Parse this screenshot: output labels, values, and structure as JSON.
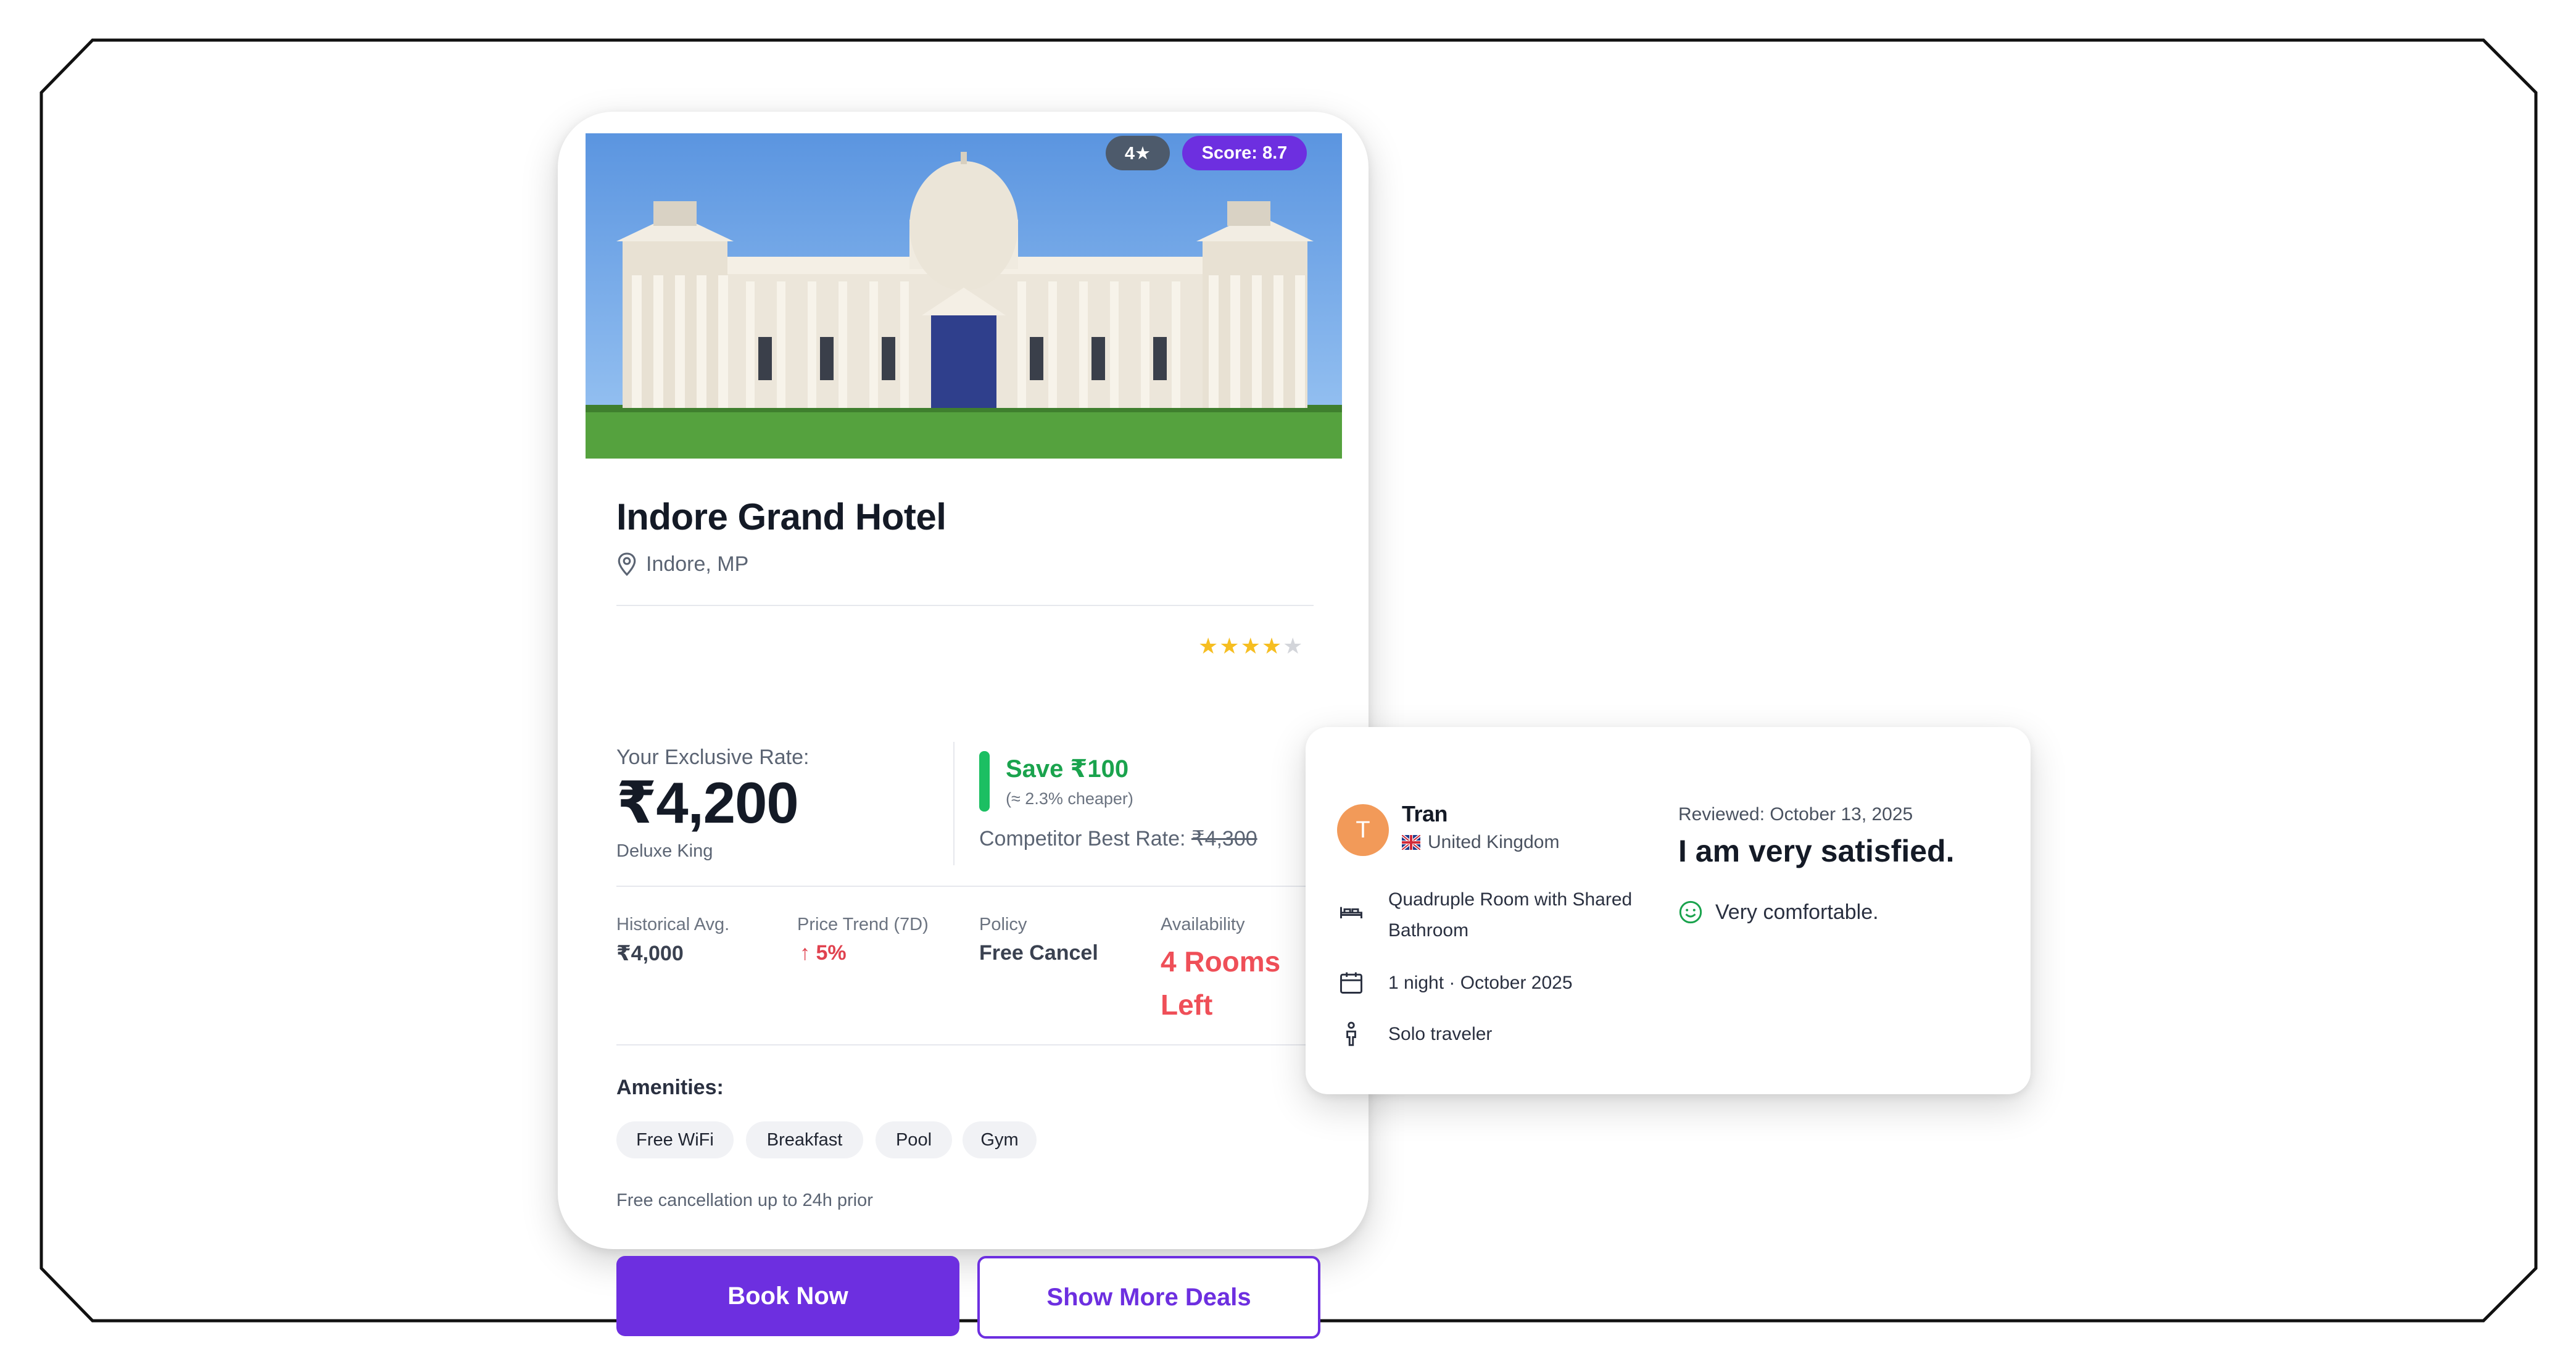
{
  "hotel": {
    "star_badge": "4★",
    "score_badge": "Score: 8.7",
    "name": "Indore Grand Hotel",
    "location": "Indore, MP",
    "star_rating": 4,
    "rate_label": "Your Exclusive Rate:",
    "price": "₹4,200",
    "room_type": "Deluxe King",
    "save_title": "Save ₹100",
    "save_sub": "(≈ 2.3% cheaper)",
    "competitor_label": "Competitor Best Rate:",
    "competitor_price": "₹4,300",
    "stats": {
      "historical_label": "Historical Avg.",
      "historical_value": "₹4,000",
      "trend_label": "Price Trend (7D)",
      "trend_value": "↑ 5%",
      "policy_label": "Policy",
      "policy_value": "Free Cancel",
      "availability_label": "Availability",
      "availability_value": "4 Rooms Left"
    },
    "amenities_title": "Amenities:",
    "amenities": [
      "Free WiFi",
      "Breakfast",
      "Pool",
      "Gym"
    ],
    "cancellation_note": "Free cancellation up to 24h prior",
    "book_label": "Book Now",
    "deals_label": "Show More Deals",
    "colors": {
      "primary": "#6d2fe0",
      "save": "#1aa34d",
      "alert": "#ef4f58",
      "star": "#f6be21"
    }
  },
  "review": {
    "avatar_letter": "T",
    "name": "Tran",
    "country": "United Kingdom",
    "room": "Quadruple Room with Shared Bathroom",
    "stay": "1 night · October 2025",
    "traveler": "Solo traveler",
    "date": "Reviewed: October 13, 2025",
    "title": "I am very satisfied.",
    "text": "Very comfortable.",
    "icons": [
      "bed-icon",
      "calendar-icon",
      "person-icon",
      "smile-icon",
      "flag-icon"
    ]
  }
}
